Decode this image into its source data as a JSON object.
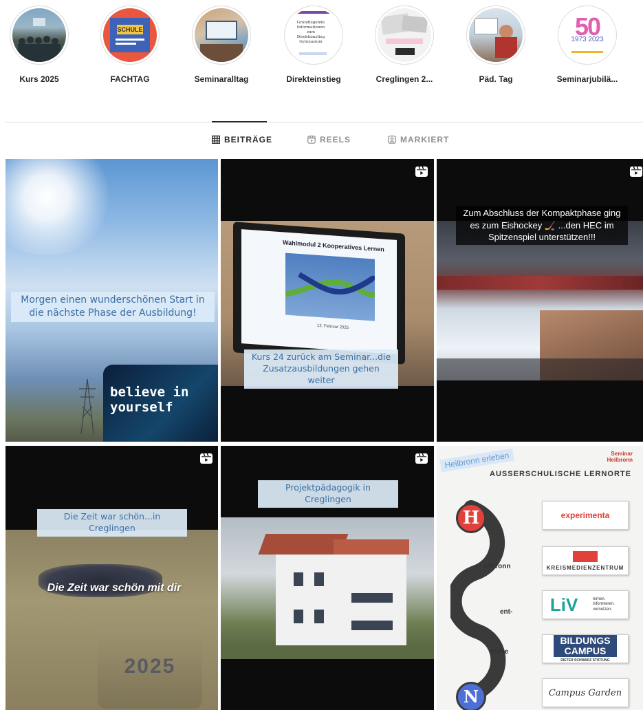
{
  "highlights": [
    {
      "label": "Kurs 2025"
    },
    {
      "label": "FACHTAG"
    },
    {
      "label": "Seminaralltag"
    },
    {
      "label": "Direkteinstieg"
    },
    {
      "label": "Creglingen 2..."
    },
    {
      "label": "Päd. Tag"
    },
    {
      "label": "Seminarjubilä..."
    }
  ],
  "highlight_text": {
    "fachtag_sign": "SCHULE",
    "direkt_text": "Grundlegende Informationen zum Direkteinstieg Gymnasium",
    "jubi_years": "1973 2023",
    "jubi_big": "50"
  },
  "tabs": {
    "posts": "BEITRÄGE",
    "reels": "REELS",
    "tagged": "MARKIERT"
  },
  "posts": {
    "p1": {
      "caption": "Morgen einen wunderschönen Start in die nächste Phase der Ausbildung!",
      "badge": "believe in yourself"
    },
    "p2": {
      "screen_title": "Wahlmodul 2 Kooperatives Lernen",
      "screen_date": "12. Februar 2025",
      "caption": "Kurs 24 zurück am Seminar...die Zusatzausbildungen gehen weiter"
    },
    "p3": {
      "caption": "Zum Abschluss der Kompaktphase ging es zum Eishockey 🏒 ...den HEC im Spitzenspiel unterstützen!!!"
    },
    "p4": {
      "caption": "Die Zeit war schön...in Creglingen",
      "overlay": "Die Zeit war schön mit dir",
      "year": "2025"
    },
    "p5": {
      "caption": "Projektpädagogik in Creglingen"
    },
    "p6": {
      "tag": "Heilbronn erleben",
      "title": "AUSSERSCHULISCHE LERNORTE",
      "letters": [
        "H",
        "N"
      ],
      "words": [
        "eilbronn",
        "ent-",
        "decke"
      ],
      "logos": [
        "experimenta",
        "KREISMEDIENZENTRUM",
        "LiV",
        "BILDUNGS CAMPUS",
        "Campus Garden"
      ],
      "liv_sub": "lernen. informieren. vernetzen.",
      "campus_sub": "DIETER SCHWARZ STIFTUNG",
      "corner": "Seminar Heilbronn"
    }
  },
  "colors": {
    "caption_bg": "#dbebf8",
    "caption_text": "#3b6ea5",
    "tab_active": "#262626",
    "tab_inactive": "#8e8e8e"
  }
}
